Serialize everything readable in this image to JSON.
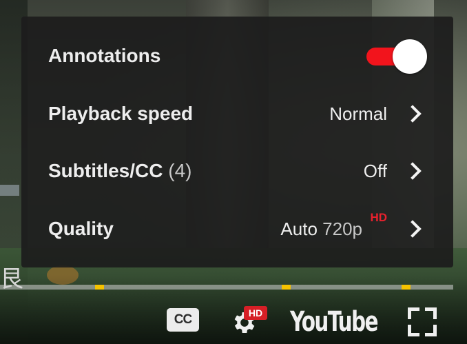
{
  "menu": {
    "items": [
      {
        "label": "Annotations",
        "toggle_on": true
      },
      {
        "label": "Playback speed",
        "value": "Normal"
      },
      {
        "label": "Subtitles/CC",
        "count": "(4)",
        "value": "Off"
      },
      {
        "label": "Quality",
        "value": "Auto",
        "value_detail": "720p",
        "badge": "HD"
      }
    ]
  },
  "controls": {
    "cc_label": "CC",
    "settings_badge": "HD",
    "logo_text": "YouTube"
  },
  "colors": {
    "accent_red": "#f2141c",
    "progress_marker": "#f6c200",
    "menu_bg": "#1c1c1c"
  },
  "progress": {
    "ad_markers": 3
  },
  "icons": [
    "gear-icon",
    "chevron-right-icon",
    "fullscreen-icon",
    "cc-icon"
  ],
  "scene": {
    "edge_glyph": "艮"
  }
}
